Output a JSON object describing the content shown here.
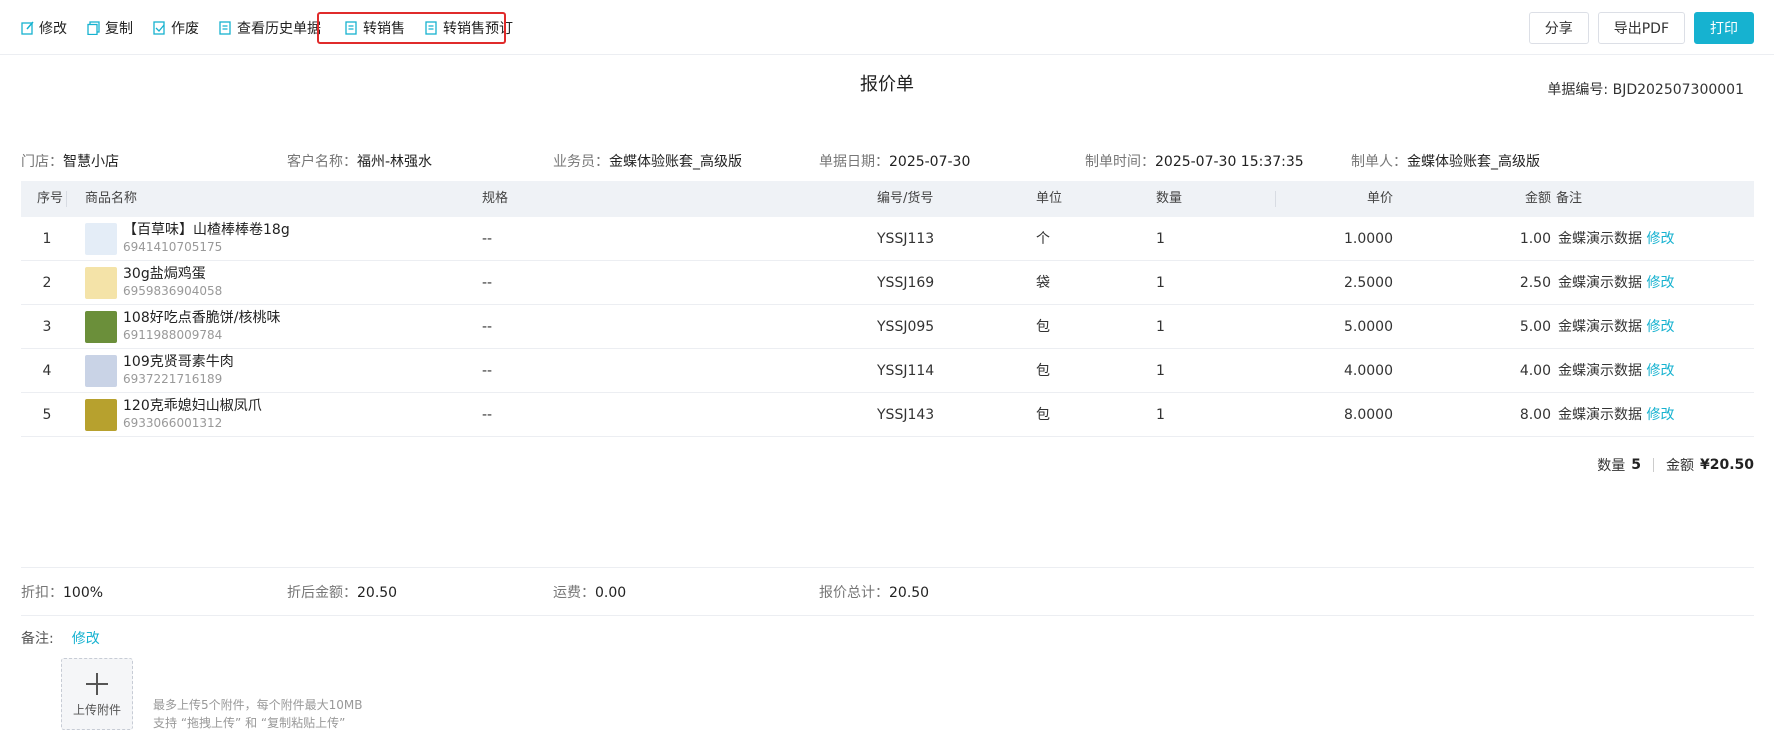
{
  "toolbar": {
    "left": [
      {
        "label": "修改",
        "icon": "edit-icon"
      },
      {
        "label": "复制",
        "icon": "copy-icon"
      },
      {
        "label": "作废",
        "icon": "void-icon"
      },
      {
        "label": "查看历史单据",
        "icon": "history-icon"
      },
      {
        "label": "转销售",
        "icon": "document-icon"
      },
      {
        "label": "转销售预订",
        "icon": "document-icon"
      }
    ],
    "share": "分享",
    "export_pdf": "导出PDF",
    "print": "打印"
  },
  "doc": {
    "title": "报价单",
    "number_label": "单据编号: ",
    "number": "BJD202507300001"
  },
  "info": {
    "store_label": "门店：",
    "store": "智慧小店",
    "customer_label": "客户名称：",
    "customer": "福州-林强水",
    "salesman_label": "业务员：",
    "salesman": "金蝶体验账套_高级版",
    "date_label": "单据日期：",
    "date": "2025-07-30",
    "created_label": "制单时间：",
    "created": "2025-07-30 15:37:35",
    "creator_label": "制单人：",
    "creator": "金蝶体验账套_高级版"
  },
  "table": {
    "headers": {
      "seq": "序号",
      "name": "商品名称",
      "spec": "规格",
      "code": "编号/货号",
      "unit": "单位",
      "qty": "数量",
      "price": "单价",
      "amount": "金额",
      "remark": "备注"
    },
    "rows": [
      {
        "seq": "1",
        "name": "【百草味】山楂棒棒卷18g",
        "barcode": "6941410705175",
        "spec": "--",
        "code": "YSSJ113",
        "unit": "个",
        "qty": "1",
        "price": "1.0000",
        "amount": "1.00",
        "remark": "金蝶演示数据",
        "edit": "修改"
      },
      {
        "seq": "2",
        "name": "30g盐焗鸡蛋",
        "barcode": "6959836904058",
        "spec": "--",
        "code": "YSSJ169",
        "unit": "袋",
        "qty": "1",
        "price": "2.5000",
        "amount": "2.50",
        "remark": "金蝶演示数据",
        "edit": "修改"
      },
      {
        "seq": "3",
        "name": "108好吃点香脆饼/核桃味",
        "barcode": "6911988009784",
        "spec": "--",
        "code": "YSSJ095",
        "unit": "包",
        "qty": "1",
        "price": "5.0000",
        "amount": "5.00",
        "remark": "金蝶演示数据",
        "edit": "修改"
      },
      {
        "seq": "4",
        "name": "109克贤哥素牛肉",
        "barcode": "6937221716189",
        "spec": "--",
        "code": "YSSJ114",
        "unit": "包",
        "qty": "1",
        "price": "4.0000",
        "amount": "4.00",
        "remark": "金蝶演示数据",
        "edit": "修改"
      },
      {
        "seq": "5",
        "name": "120克乖媳妇山椒凤爪",
        "barcode": "6933066001312",
        "spec": "--",
        "code": "YSSJ143",
        "unit": "包",
        "qty": "1",
        "price": "8.0000",
        "amount": "8.00",
        "remark": "金蝶演示数据",
        "edit": "修改"
      }
    ],
    "thumb_colors": [
      "#e4edf7",
      "#f4e3a8",
      "#6b8f3a",
      "#c9d3e6",
      "#b7a12e"
    ]
  },
  "totals": {
    "qty_label": "数量",
    "qty": "5",
    "amount_label": "金额",
    "amount": "¥20.50"
  },
  "summary": {
    "discount_label": "折扣：",
    "discount": "100%",
    "after_label": "折后金额：",
    "after": "20.50",
    "freight_label": "运费：",
    "freight": "0.00",
    "total_label": "报价总计：",
    "total": "20.50"
  },
  "remark": {
    "label": "备注:",
    "edit": "修改"
  },
  "upload": {
    "label": "上传附件",
    "hint1": "最多上传5个附件，每个附件最大10MB",
    "hint2": "支持 “拖拽上传” 和 “复制粘贴上传”"
  },
  "colors": {
    "accent": "#16b2d0",
    "highlight_box": "#e02b2b"
  }
}
